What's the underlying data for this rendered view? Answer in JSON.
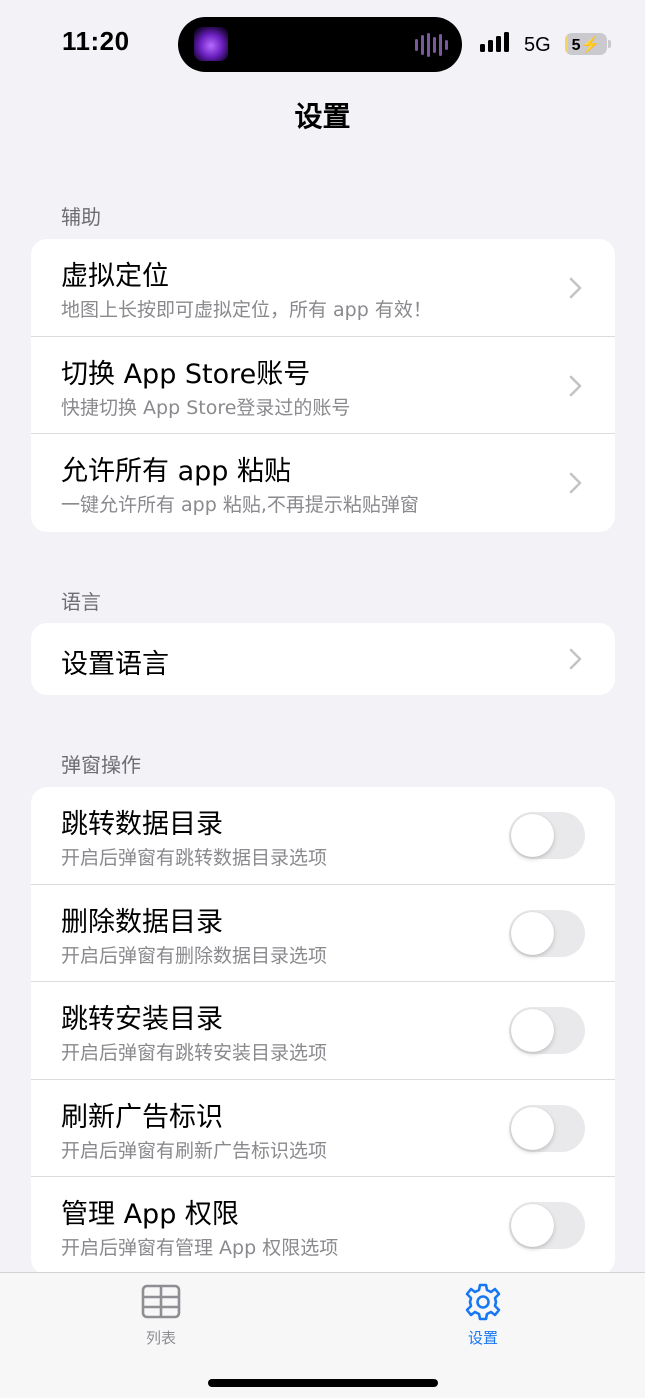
{
  "status_bar": {
    "time": "11:20",
    "network": "5G",
    "battery_level": "5",
    "battery_fraction": 0.08,
    "charging_icon": "bolt-icon",
    "island_app_icon": "app-thumbnail-icon",
    "island_activity_icon": "audio-wave-icon"
  },
  "header": {
    "title": "设置"
  },
  "sections": {
    "assist": {
      "header": "辅助",
      "rows": [
        {
          "title": "虚拟定位",
          "subtitle": "地图上长按即可虚拟定位，所有 app 有效！"
        },
        {
          "title": "切换 App Store账号",
          "subtitle": "快捷切换 App Store登录过的账号"
        },
        {
          "title": "允许所有 app 粘贴",
          "subtitle": "一键允许所有 app 粘贴,不再提示粘贴弹窗"
        }
      ]
    },
    "language": {
      "header": "语言",
      "rows": [
        {
          "title": "设置语言"
        }
      ]
    },
    "popup": {
      "header": "弹窗操作",
      "rows": [
        {
          "title": "跳转数据目录",
          "subtitle": "开启后弹窗有跳转数据目录选项",
          "enabled": false
        },
        {
          "title": "删除数据目录",
          "subtitle": "开启后弹窗有删除数据目录选项",
          "enabled": false
        },
        {
          "title": "跳转安装目录",
          "subtitle": "开启后弹窗有跳转安装目录选项",
          "enabled": false
        },
        {
          "title": "刷新广告标识",
          "subtitle": "开启后弹窗有刷新广告标识选项",
          "enabled": false
        },
        {
          "title": "管理 App 权限",
          "subtitle": "开启后弹窗有管理 App 权限选项",
          "enabled": false
        }
      ]
    }
  },
  "tab_bar": {
    "tabs": [
      {
        "label": "列表",
        "icon": "table-grid-icon",
        "selected": false
      },
      {
        "label": "设置",
        "icon": "gear-icon",
        "selected": true
      }
    ]
  },
  "colors": {
    "background": "#f2f2f7",
    "accent": "#1877f2",
    "toggle_off": "#e9e9eb",
    "secondary_text": "#8a8a8e"
  }
}
